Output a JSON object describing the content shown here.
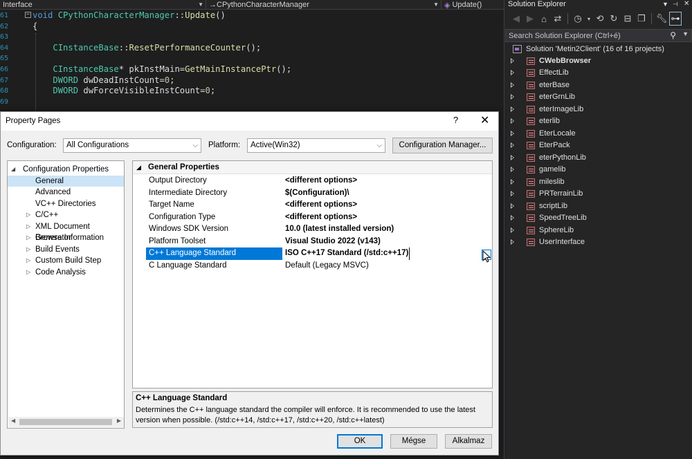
{
  "editor": {
    "nav": {
      "project": "Interface",
      "class": "→CPythonCharacterManager",
      "method": "Update()"
    },
    "lines": [
      {
        "num": "61",
        "fold": "−",
        "parts": [
          {
            "c": "kw",
            "t": "void "
          },
          {
            "c": "ty",
            "t": "CPythonCharacterManager"
          },
          {
            "c": "",
            "t": "::"
          },
          {
            "c": "fn",
            "t": "Update"
          },
          {
            "c": "",
            "t": "()"
          }
        ]
      },
      {
        "num": "62",
        "fold": "",
        "parts": [
          {
            "c": "",
            "t": "{"
          }
        ]
      },
      {
        "num": "63",
        "fold": "",
        "parts": []
      },
      {
        "num": "64",
        "fold": "",
        "parts": [
          {
            "c": "",
            "t": "    "
          },
          {
            "c": "ty",
            "t": "CInstanceBase"
          },
          {
            "c": "",
            "t": "::"
          },
          {
            "c": "fn",
            "t": "ResetPerformanceCounter"
          },
          {
            "c": "",
            "t": "();"
          }
        ]
      },
      {
        "num": "65",
        "fold": "",
        "parts": []
      },
      {
        "num": "66",
        "fold": "",
        "parts": [
          {
            "c": "",
            "t": "    "
          },
          {
            "c": "ty",
            "t": "CInstanceBase"
          },
          {
            "c": "",
            "t": "* pkInstMain="
          },
          {
            "c": "fn",
            "t": "GetMainInstancePtr"
          },
          {
            "c": "",
            "t": "();"
          }
        ]
      },
      {
        "num": "67",
        "fold": "",
        "parts": [
          {
            "c": "",
            "t": "    "
          },
          {
            "c": "ty",
            "t": "DWORD"
          },
          {
            "c": "",
            "t": " dwDeadInstCount="
          },
          {
            "c": "nm",
            "t": "0"
          },
          {
            "c": "",
            "t": ";"
          }
        ]
      },
      {
        "num": "68",
        "fold": "",
        "parts": [
          {
            "c": "",
            "t": "    "
          },
          {
            "c": "ty",
            "t": "DWORD"
          },
          {
            "c": "",
            "t": " dwForceVisibleInstCount="
          },
          {
            "c": "nm",
            "t": "0"
          },
          {
            "c": "",
            "t": ";"
          }
        ]
      },
      {
        "num": "69",
        "fold": "",
        "parts": []
      }
    ]
  },
  "solution_explorer": {
    "title": "Solution Explorer",
    "search_placeholder": "Search Solution Explorer (Ctrl+é)",
    "solution_label": "Solution 'Metin2Client' (16 of 16 projects)",
    "projects": [
      {
        "name": "CWebBrowser",
        "bold": true
      },
      {
        "name": "EffectLib"
      },
      {
        "name": "eterBase"
      },
      {
        "name": "eterGrnLib"
      },
      {
        "name": "eterImageLib"
      },
      {
        "name": "eterlib"
      },
      {
        "name": "EterLocale"
      },
      {
        "name": "EterPack"
      },
      {
        "name": "eterPythonLib"
      },
      {
        "name": "gamelib"
      },
      {
        "name": "mileslib"
      },
      {
        "name": "PRTerrainLib"
      },
      {
        "name": "scriptLib"
      },
      {
        "name": "SpeedTreeLib"
      },
      {
        "name": "SphereLib"
      },
      {
        "name": "UserInterface"
      }
    ]
  },
  "dialog": {
    "title": "Property Pages",
    "help": "?",
    "close": "✕",
    "configuration_label": "Configuration:",
    "configuration_value": "All Configurations",
    "platform_label": "Platform:",
    "platform_value": "Active(Win32)",
    "config_manager_button": "Configuration Manager...",
    "tree": [
      {
        "label": "Configuration Properties",
        "indent": 0,
        "expander": "◢"
      },
      {
        "label": "General",
        "indent": 1,
        "selected": true
      },
      {
        "label": "Advanced",
        "indent": 1
      },
      {
        "label": "VC++ Directories",
        "indent": 1
      },
      {
        "label": "C/C++",
        "indent": 1,
        "expander": "▷"
      },
      {
        "label": "XML Document Generator",
        "indent": 1,
        "expander": "▷"
      },
      {
        "label": "Browse Information",
        "indent": 1,
        "expander": "▷"
      },
      {
        "label": "Build Events",
        "indent": 1,
        "expander": "▷"
      },
      {
        "label": "Custom Build Step",
        "indent": 1,
        "expander": "▷"
      },
      {
        "label": "Code Analysis",
        "indent": 1,
        "expander": "▷"
      }
    ],
    "grid_header": "General Properties",
    "properties": [
      {
        "name": "Output Directory",
        "value": "<different options>",
        "bold": true
      },
      {
        "name": "Intermediate Directory",
        "value": "$(Configuration)\\",
        "bold": true
      },
      {
        "name": "Target Name",
        "value": "<different options>",
        "bold": true
      },
      {
        "name": "Configuration Type",
        "value": "<different options>",
        "bold": true
      },
      {
        "name": "Windows SDK Version",
        "value": "10.0 (latest installed version)",
        "bold": true
      },
      {
        "name": "Platform Toolset",
        "value": "Visual Studio 2022 (v143)",
        "bold": true
      },
      {
        "name": "C++ Language Standard",
        "value": "ISO C++17 Standard (/std:c++17)",
        "bold": true,
        "selected": true
      },
      {
        "name": "C Language Standard",
        "value": "Default (Legacy MSVC)",
        "bold": false
      }
    ],
    "description_title": "C++ Language Standard",
    "description_text": "Determines the C++ language standard the compiler will enforce. It is recommended to use the latest version when possible.  (/std:c++14, /std:c++17, /std:c++20, /std:c++latest)",
    "ok_button": "OK",
    "cancel_button": "Mégse",
    "apply_button": "Alkalmaz"
  }
}
